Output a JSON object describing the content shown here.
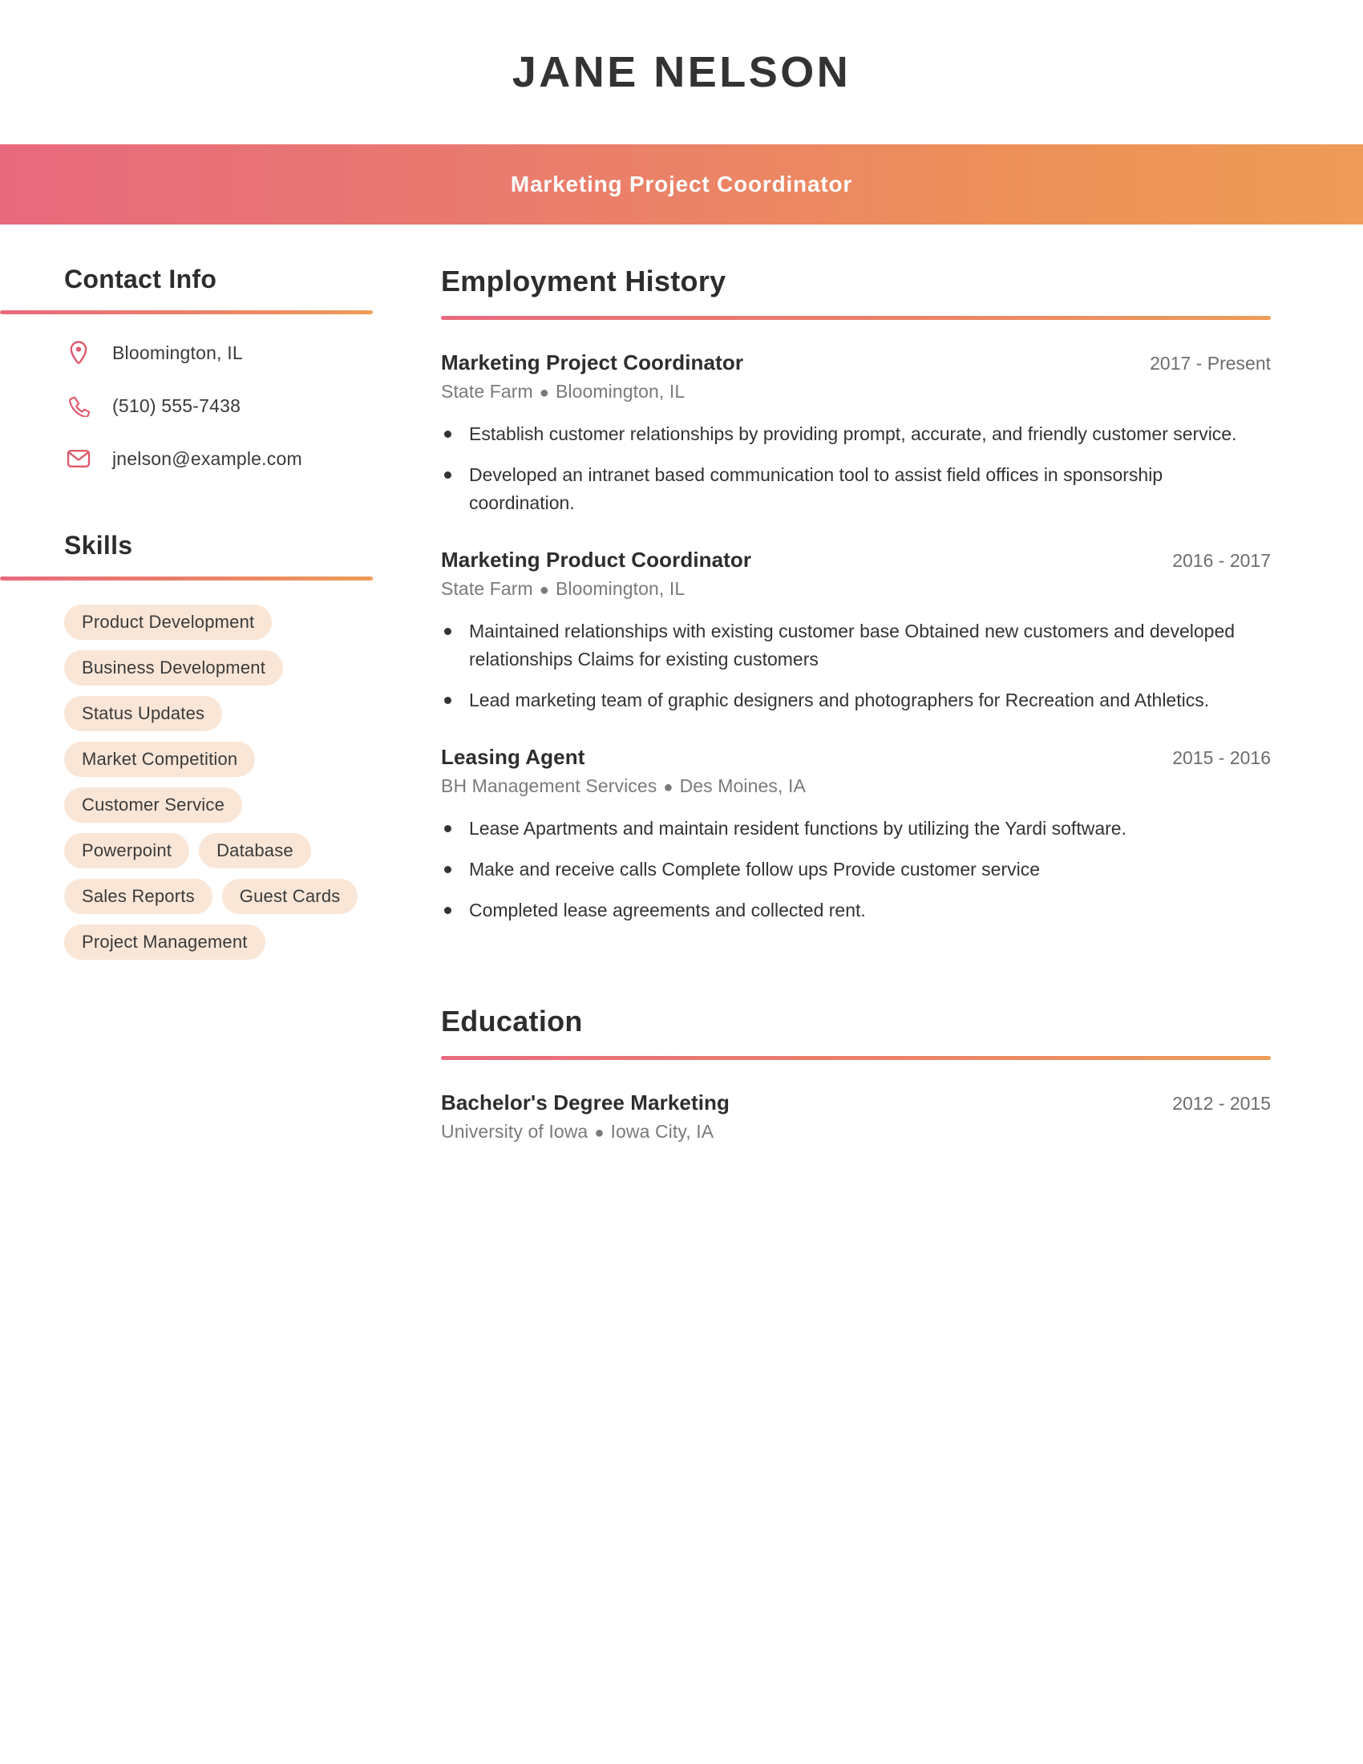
{
  "header": {
    "name": "JANE NELSON",
    "title": "Marketing Project Coordinator"
  },
  "theme": {
    "gradient_start": "#e8697d",
    "gradient_end": "#ee9c57",
    "pill_background": "#fae6d7",
    "heading_color": "#2d2d2d",
    "body_text_color": "#333333",
    "muted_text_color": "#7a7a7a",
    "icon_color": "#e05a6e"
  },
  "sidebar": {
    "contact": {
      "heading": "Contact Info",
      "items": [
        {
          "icon": "location-pin-icon",
          "value": "Bloomington, IL"
        },
        {
          "icon": "phone-icon",
          "value": "(510) 555-7438"
        },
        {
          "icon": "envelope-icon",
          "value": "jnelson@example.com"
        }
      ]
    },
    "skills": {
      "heading": "Skills",
      "items": [
        "Product Development",
        "Business Development",
        "Status Updates",
        "Market Competition",
        "Customer Service",
        "Powerpoint",
        "Database",
        "Sales Reports",
        "Guest Cards",
        "Project Management"
      ]
    }
  },
  "main": {
    "employment": {
      "heading": "Employment History",
      "entries": [
        {
          "role": "Marketing Project Coordinator",
          "dates": "2017 - Present",
          "company": "State Farm",
          "location": "Bloomington, IL",
          "bullets": [
            "Establish customer relationships by providing prompt, accurate, and friendly customer service.",
            "Developed an intranet based communication tool to assist field offices in sponsorship coordination."
          ]
        },
        {
          "role": "Marketing Product Coordinator",
          "dates": "2016 - 2017",
          "company": "State Farm",
          "location": "Bloomington, IL",
          "bullets": [
            "Maintained relationships with existing customer base Obtained new customers and developed relationships Claims for existing customers",
            "Lead marketing team of graphic designers and photographers for Recreation and Athletics."
          ]
        },
        {
          "role": "Leasing Agent",
          "dates": "2015 - 2016",
          "company": "BH Management Services",
          "location": "Des Moines, IA",
          "bullets": [
            "Lease Apartments and maintain resident functions by utilizing the Yardi software.",
            "Make and receive calls Complete follow ups Provide customer service",
            "Completed lease agreements and collected rent."
          ]
        }
      ]
    },
    "education": {
      "heading": "Education",
      "entries": [
        {
          "role": "Bachelor's Degree Marketing",
          "dates": "2012 - 2015",
          "company": "University of Iowa",
          "location": "Iowa City, IA"
        }
      ]
    }
  }
}
